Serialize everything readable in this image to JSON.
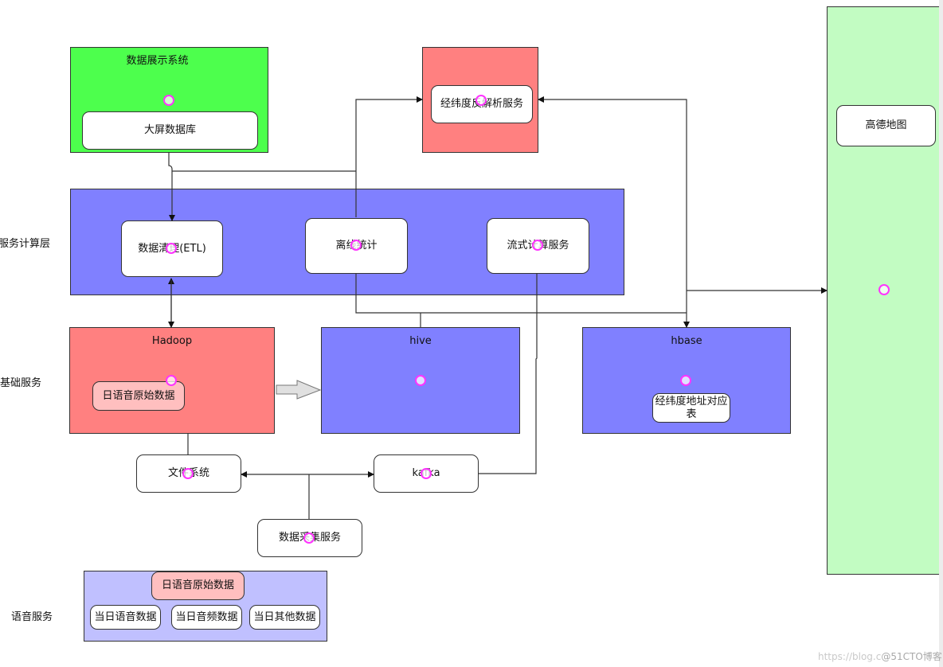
{
  "colors": {
    "display_green": "#4dff4d",
    "map_green": "#c2fcc2",
    "red": "#ff8080",
    "blue": "#8080ff",
    "voice_bg": "#c0c0ff",
    "pink_node": "#ffbfbf",
    "handle": "#ff33ff"
  },
  "lanes": {
    "compute": "服务计算层",
    "base": "基础服务",
    "voice": "语音服务"
  },
  "containers": {
    "display_system": {
      "title": "数据展示系统",
      "node": "大屏数据库"
    },
    "geo_service": {
      "node": "经纬度反解析服务"
    },
    "compute_layer": {
      "nodes": [
        "数据清理(ETL)",
        "离线统计",
        "流式计算服务"
      ]
    },
    "hadoop": {
      "title": "Hadoop",
      "node": "日语音原始数据"
    },
    "hive": {
      "title": "hive"
    },
    "hbase": {
      "title": "hbase",
      "node_line1": "经纬度地址对应",
      "node_line2": "表"
    },
    "amap": {
      "node": "高德地图"
    },
    "voice_service": {
      "header_node": "日语音原始数据",
      "nodes": [
        "当日语音数据",
        "当日音频数据",
        "当日其他数据"
      ]
    }
  },
  "standalone_nodes": {
    "file_system": "文件系统",
    "kafka": "kafka",
    "data_collection": "数据采集服务"
  },
  "watermark": {
    "url": "https://blog.c",
    "brand": "@51CTO博客"
  }
}
